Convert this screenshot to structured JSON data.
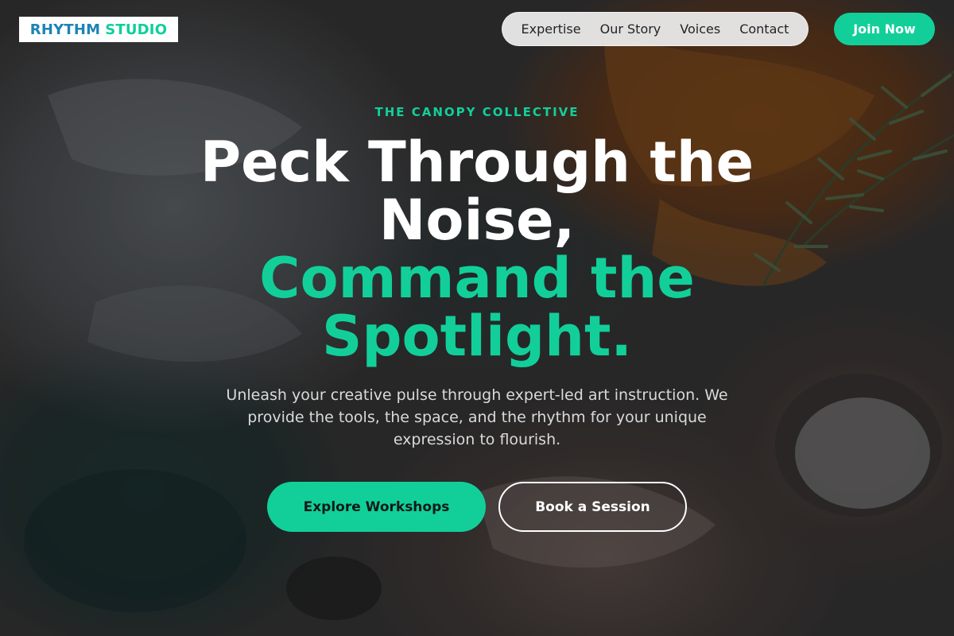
{
  "brand": {
    "word1": "RHYTHM",
    "word2": "STUDIO"
  },
  "nav": {
    "items": [
      "Expertise",
      "Our Story",
      "Voices",
      "Contact"
    ]
  },
  "cta": {
    "join": "Join Now"
  },
  "hero": {
    "eyebrow": "THE CANOPY COLLECTIVE",
    "headline_line1": "Peck Through the",
    "headline_line2": "Noise,",
    "accent_line1": "Command the",
    "accent_line2": "Spotlight.",
    "subtitle": "Unleash your creative pulse through expert-led art instruction. We provide the tools, the space, and the rhythm for your unique expression to flourish.",
    "primary_button": "Explore Workshops",
    "secondary_button": "Book a Session"
  },
  "colors": {
    "accent": "#12cf9a",
    "brand_blue": "#1d84b5",
    "nav_bg": "#f0f0f0"
  },
  "background": {
    "image": "textured-paint-palette"
  }
}
